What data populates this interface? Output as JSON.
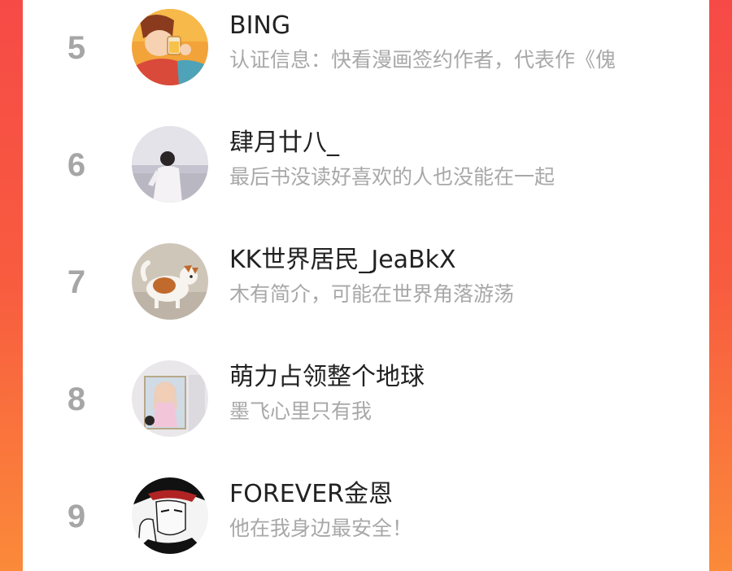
{
  "colors": {
    "background_gradient_top": "#f64a46",
    "background_gradient_bottom": "#fb8a3a",
    "card": "#ffffff",
    "rank_text": "#a6a6a6",
    "name_text": "#222222",
    "bio_text": "#a8a8a8"
  },
  "ranking": {
    "items": [
      {
        "rank": "5",
        "name": "BING",
        "bio": "认证信息：快看漫画签约作者，代表作《傀",
        "avatar_icon": "avatar-cartoon-drinking"
      },
      {
        "rank": "6",
        "name": "肆月廿八_",
        "bio": "最后书没读好喜欢的人也没能在一起",
        "avatar_icon": "avatar-person-beach"
      },
      {
        "rank": "7",
        "name": "KK世界居民_JeaBkX",
        "bio": "木有简介，可能在世界角落游荡",
        "avatar_icon": "avatar-dog"
      },
      {
        "rank": "8",
        "name": "萌力占领整个地球",
        "bio": "墨飞心里只有我",
        "avatar_icon": "avatar-anime-poster"
      },
      {
        "rank": "9",
        "name": "FOREVER金恩",
        "bio": "他在我身边最安全！",
        "avatar_icon": "avatar-manga-man"
      }
    ]
  }
}
